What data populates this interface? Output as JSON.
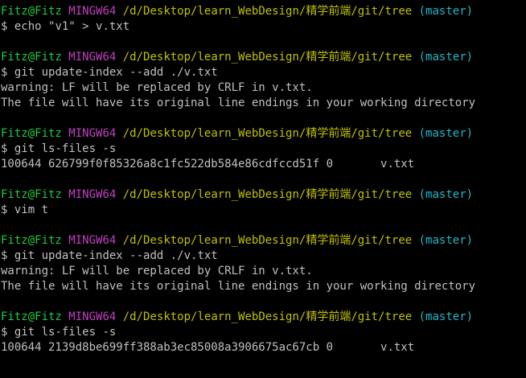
{
  "prompt": {
    "user": "Fitz@Fitz",
    "system": "MINGW64",
    "path": "/d/Desktop/learn_WebDesign/精学前端/git/tree",
    "branch": "(master)",
    "symbol": "$"
  },
  "colors": {
    "background": "#000000",
    "text": "#c0c0c0",
    "user": "#1ccc3c",
    "system": "#c040c0",
    "path": "#c0c000",
    "branch": "#20b8c8"
  },
  "lines": [
    {
      "type": "prompt"
    },
    {
      "type": "command",
      "text": "echo \"v1\" > v.txt"
    },
    {
      "type": "blank"
    },
    {
      "type": "prompt"
    },
    {
      "type": "command",
      "text": "git update-index --add ./v.txt"
    },
    {
      "type": "output",
      "text": "warning: LF will be replaced by CRLF in v.txt."
    },
    {
      "type": "output",
      "text": "The file will have its original line endings in your working directory"
    },
    {
      "type": "blank"
    },
    {
      "type": "prompt"
    },
    {
      "type": "command",
      "text": "git ls-files -s"
    },
    {
      "type": "output",
      "text": "100644 626799f0f85326a8c1fc522db584e86cdfccd51f 0\tv.txt"
    },
    {
      "type": "blank"
    },
    {
      "type": "prompt"
    },
    {
      "type": "command",
      "text": "vim t"
    },
    {
      "type": "blank"
    },
    {
      "type": "prompt"
    },
    {
      "type": "command",
      "text": "git update-index --add ./v.txt"
    },
    {
      "type": "output",
      "text": "warning: LF will be replaced by CRLF in v.txt."
    },
    {
      "type": "output",
      "text": "The file will have its original line endings in your working directory"
    },
    {
      "type": "blank"
    },
    {
      "type": "prompt"
    },
    {
      "type": "command",
      "text": "git ls-files -s"
    },
    {
      "type": "output",
      "text": "100644 2139d8be699ff388ab3ec85008a3906675ac67cb 0\tv.txt"
    }
  ]
}
